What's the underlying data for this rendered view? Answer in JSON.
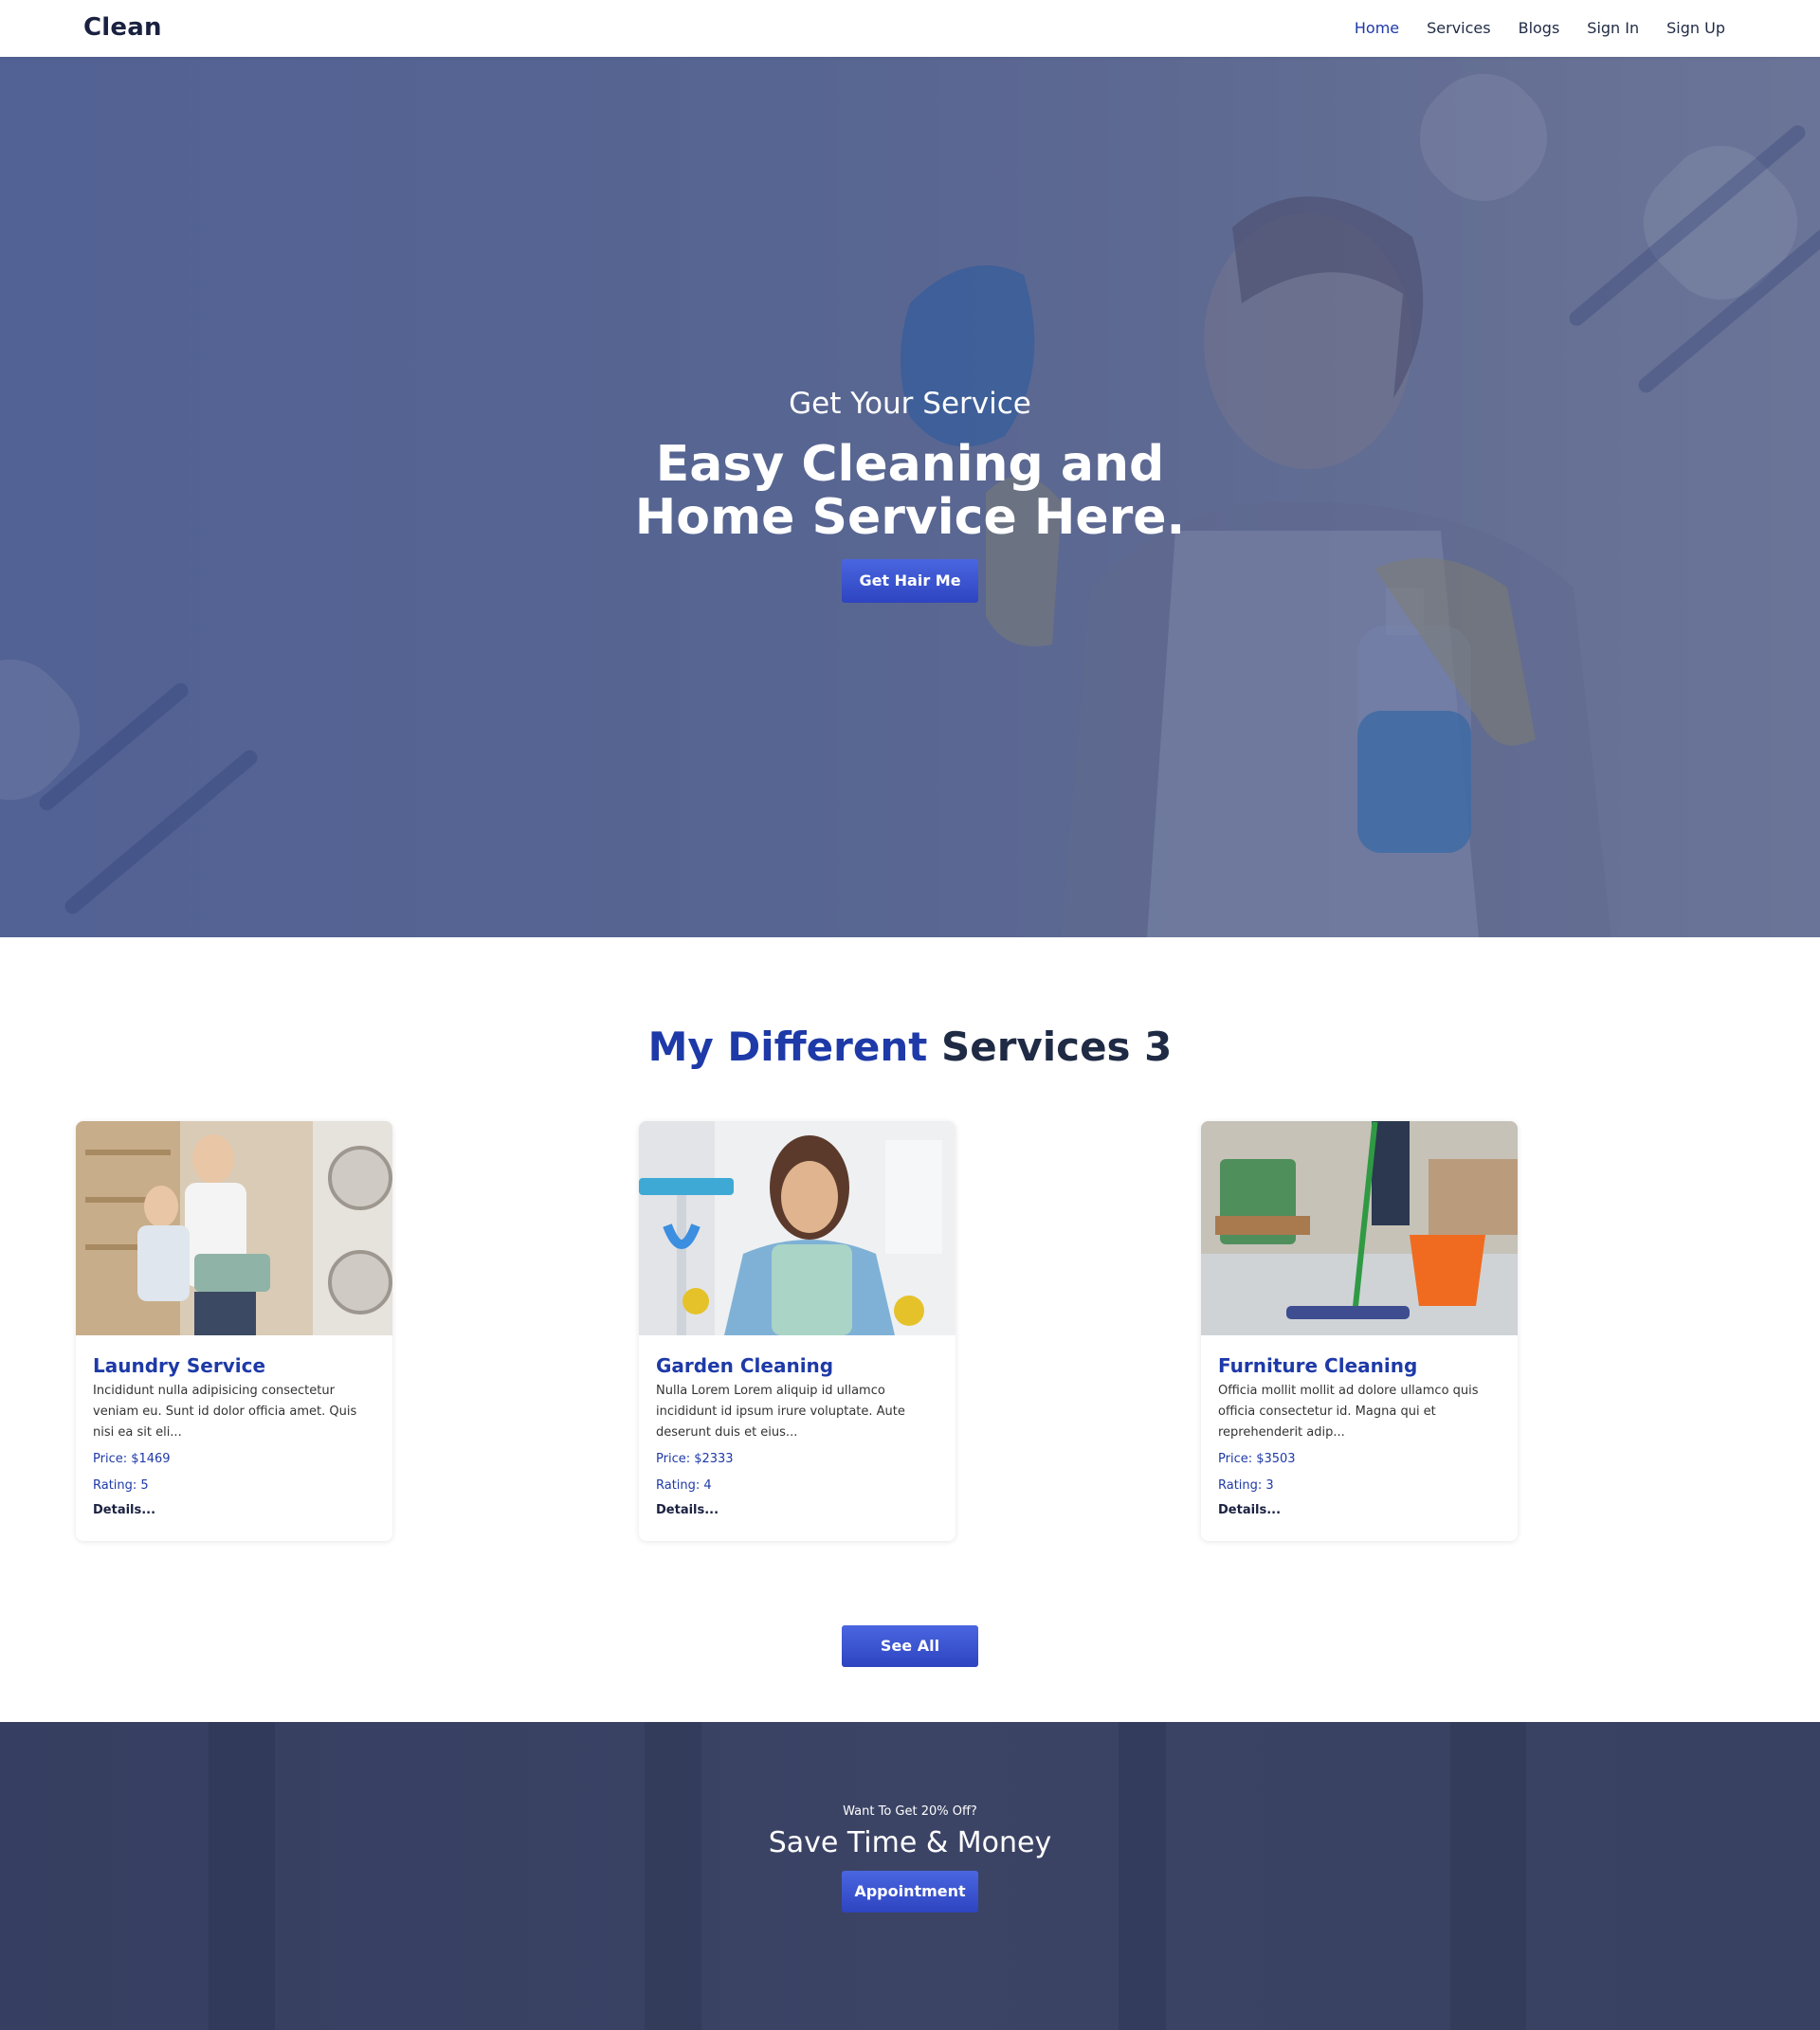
{
  "nav": {
    "logo": "Clean",
    "links": [
      "Home",
      "Services",
      "Blogs",
      "Sign In",
      "Sign Up"
    ]
  },
  "hero": {
    "subtitle": "Get Your Service",
    "title_line1": "Easy Cleaning and",
    "title_line2": "Home Service Here.",
    "button": "Get Hair Me"
  },
  "services": {
    "heading_part1": "My Different",
    "heading_part2": "Services 3",
    "cards": [
      {
        "title": "Laundry Service",
        "description": "Incididunt nulla adipisicing consectetur veniam eu. Sunt id dolor officia amet. Quis nisi ea sit eli...",
        "price": "Price: $1469",
        "rating": "Rating: 5",
        "details": "Details..."
      },
      {
        "title": "Garden Cleaning",
        "description": "Nulla Lorem Lorem aliquip id ullamco incididunt id ipsum irure voluptate. Aute deserunt duis et eius...",
        "price": "Price: $2333",
        "rating": "Rating: 4",
        "details": "Details..."
      },
      {
        "title": "Furniture Cleaning",
        "description": "Officia mollit mollit ad dolore ullamco quis officia consectetur id. Magna qui et reprehenderit adip...",
        "price": "Price: $3503",
        "rating": "Rating: 3",
        "details": "Details..."
      }
    ],
    "see_all": "See All"
  },
  "promo": {
    "subtitle": "Want To Get 20% Off?",
    "title": "Save Time & Money",
    "button": "Appointment"
  },
  "colors": {
    "accent": "#1e3aa8",
    "button": "#3550d0",
    "dark_text": "#1f2a44"
  }
}
